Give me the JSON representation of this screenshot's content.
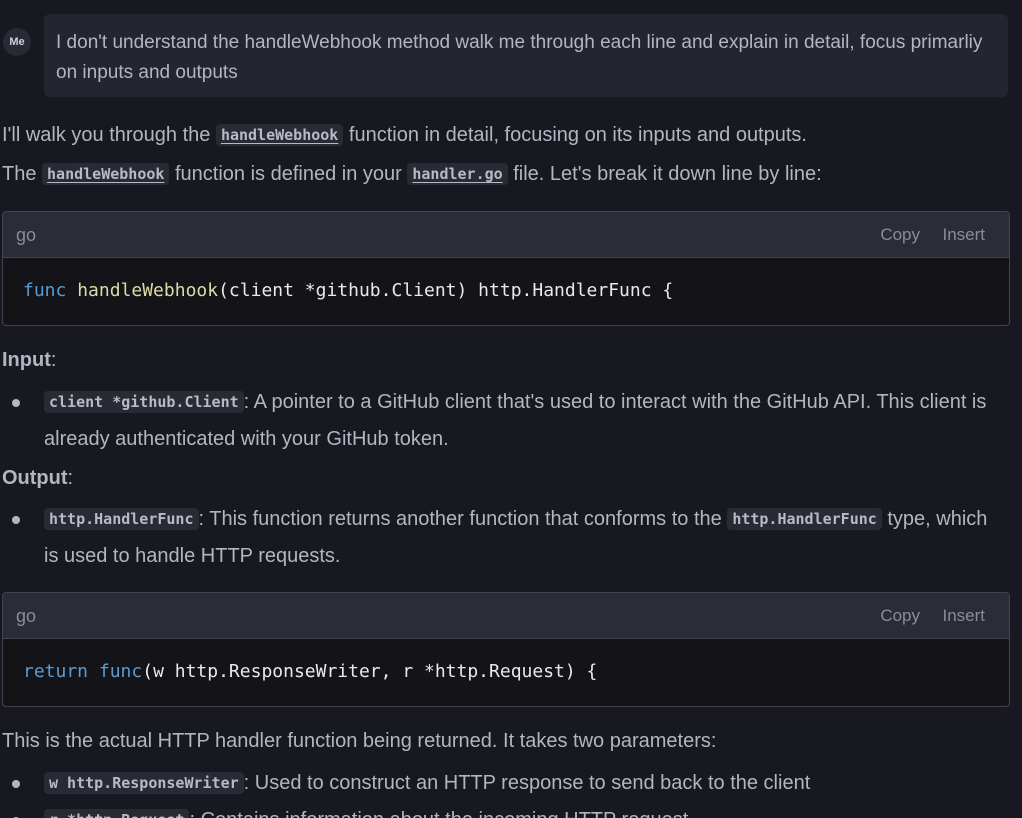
{
  "user_message": {
    "avatar": "Me",
    "text": "I don't understand the handleWebhook method walk me through each line and explain in detail, focus primarliy on inputs and outputs"
  },
  "response": {
    "intro_1": {
      "pre": "I'll walk you through the ",
      "code": "handleWebhook",
      "post": " function in detail, focusing on its inputs and outputs."
    },
    "intro_2": {
      "pre": "The ",
      "code1": "handleWebhook",
      "mid": " function is defined in your ",
      "code2": "handler.go",
      "post": " file. Let's break it down line by line:"
    },
    "code_block_1": {
      "lang": "go",
      "copy": "Copy",
      "insert": "Insert",
      "kw": "func",
      "fn": "handleWebhook",
      "rest": "(client *github.Client) http.HandlerFunc {"
    },
    "input_heading": "Input",
    "input_item": {
      "code": "client *github.Client",
      "text": ": A pointer to a GitHub client that's used to interact with the GitHub API. This client is already authenticated with your GitHub token."
    },
    "output_heading": "Output",
    "output_item": {
      "code": "http.HandlerFunc",
      "text_pre": ": This function returns another function that conforms to the ",
      "code2": "http.HandlerFunc",
      "text_post": " type, which is used to handle HTTP requests."
    },
    "code_block_2": {
      "lang": "go",
      "copy": "Copy",
      "insert": "Insert",
      "kw1": "return",
      "kw2": "func",
      "rest": "(w http.ResponseWriter, r *http.Request) {"
    },
    "params_intro": "This is the actual HTTP handler function being returned. It takes two parameters:",
    "param_w": {
      "code": "w http.ResponseWriter",
      "text": ": Used to construct an HTTP response to send back to the client"
    },
    "param_r": {
      "code": "r *http.Request",
      "text": ": Contains information about the incoming HTTP request"
    }
  }
}
